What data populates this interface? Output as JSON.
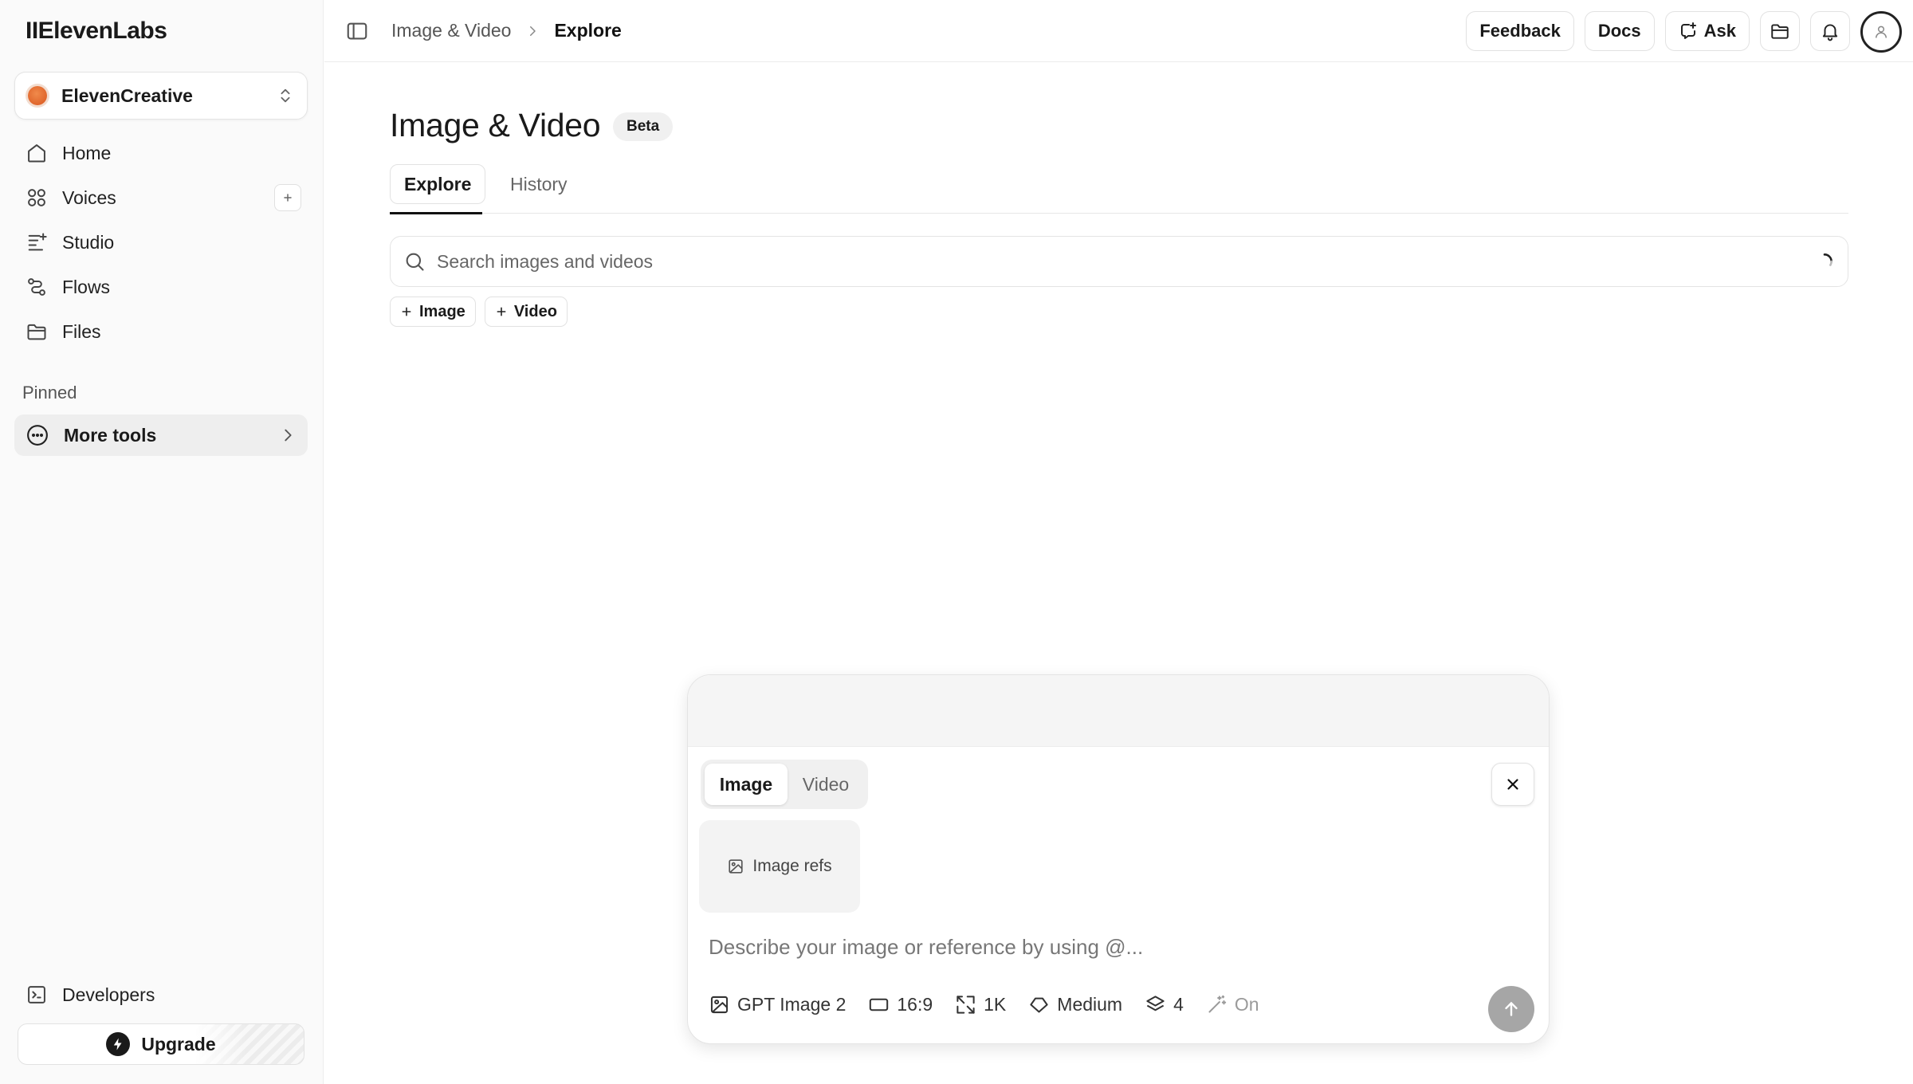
{
  "app": {
    "logo": "IIElevenLabs"
  },
  "sidebar": {
    "workspace": {
      "name": "ElevenCreative",
      "icon": "orange-orb-icon"
    },
    "items": [
      {
        "label": "Home",
        "icon": "home-icon"
      },
      {
        "label": "Voices",
        "icon": "voices-icon",
        "action": "+"
      },
      {
        "label": "Studio",
        "icon": "studio-icon"
      },
      {
        "label": "Flows",
        "icon": "flows-icon"
      },
      {
        "label": "Files",
        "icon": "folder-icon"
      }
    ],
    "pinned_label": "Pinned",
    "more_tools": {
      "label": "More tools"
    },
    "developers": {
      "label": "Developers"
    },
    "upgrade": {
      "label": "Upgrade"
    }
  },
  "topbar": {
    "breadcrumb": [
      "Image & Video",
      "Explore"
    ],
    "actions": {
      "feedback": "Feedback",
      "docs": "Docs",
      "ask": "Ask"
    }
  },
  "main": {
    "title": "Image & Video",
    "badge": "Beta",
    "tabs": [
      {
        "label": "Explore",
        "active": true
      },
      {
        "label": "History",
        "active": false
      }
    ],
    "search": {
      "placeholder": "Search images and videos",
      "value": ""
    },
    "filters": [
      {
        "label": "Image"
      },
      {
        "label": "Video"
      }
    ]
  },
  "composer": {
    "modes": [
      {
        "label": "Image",
        "active": true
      },
      {
        "label": "Video",
        "active": false
      }
    ],
    "refs_label": "Image refs",
    "prompt_placeholder": "Describe your image or reference by using @...",
    "options": {
      "model": "GPT Image 2",
      "aspect": "16:9",
      "resolution": "1K",
      "quality": "Medium",
      "count": "4",
      "enhance": "On"
    }
  },
  "colors": {
    "accent": "#111111",
    "send_disabled": "#a6a6a6",
    "workspace_orb": "#e8692e"
  }
}
